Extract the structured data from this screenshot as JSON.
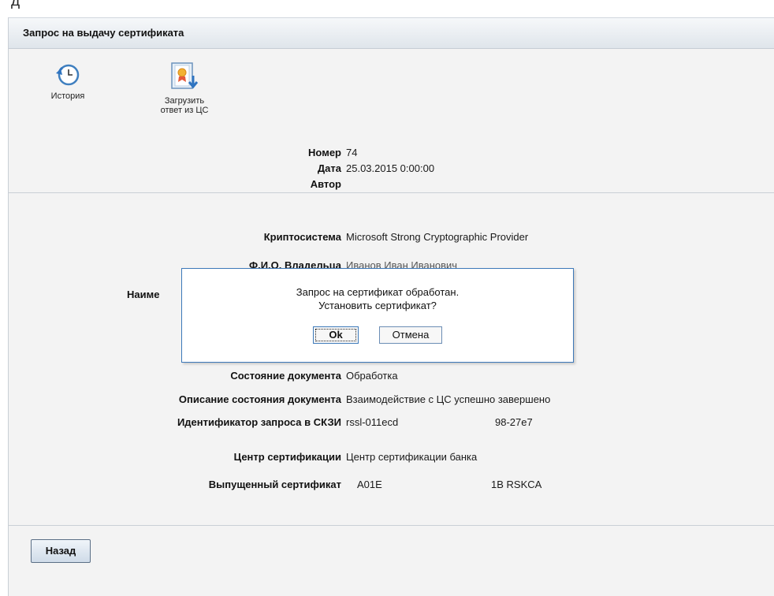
{
  "top_text": "д",
  "panel": {
    "title": "Запрос на выдачу сертификата",
    "tools": [
      {
        "label_line1": "История",
        "label_line2": "",
        "icon": "history-clock-icon"
      },
      {
        "label_line1": "Загрузить",
        "label_line2": "ответ из ЦС",
        "icon": "upload-certificate-icon"
      }
    ]
  },
  "header_fields": {
    "number": {
      "label": "Номер",
      "value": "74"
    },
    "date": {
      "label": "Дата",
      "value": "25.03.2015 0:00:00"
    },
    "author": {
      "label": "Автор",
      "value": ""
    }
  },
  "fields": {
    "crypto": {
      "label": "Криптосистема",
      "value": "Microsoft Strong Cryptographic Provider"
    },
    "owner": {
      "label": "Ф.И.О. Владельца",
      "value": "Иванов Иван Иванович"
    },
    "name": {
      "label": "Наиме",
      "value": ""
    },
    "state": {
      "label": "Состояние документа",
      "value": "Обработка"
    },
    "state_desc": {
      "label": "Описание состояния документа",
      "value": "Взаимодействие с ЦС успешно завершено"
    },
    "request_id": {
      "label": "Идентификатор запроса в СКЗИ",
      "value_part1": "rssl-011ecd",
      "value_part2": "98-27e7"
    },
    "ca": {
      "label": "Центр сертификации",
      "value": "Центр сертификации банка"
    },
    "issued": {
      "label": "Выпущенный сертификат",
      "value_part1": "A01E",
      "value_part2": "1B RSKCA"
    }
  },
  "back_button": "Назад",
  "dialog": {
    "line1": "Запрос на сертификат обработан.",
    "line2": "Установить сертификат?",
    "ok": "Ok",
    "cancel": "Отмена"
  },
  "colors": {
    "panel_bg": "#f3f3f3",
    "dialog_border": "#3d79b9",
    "button_border": "#5b6f86"
  }
}
